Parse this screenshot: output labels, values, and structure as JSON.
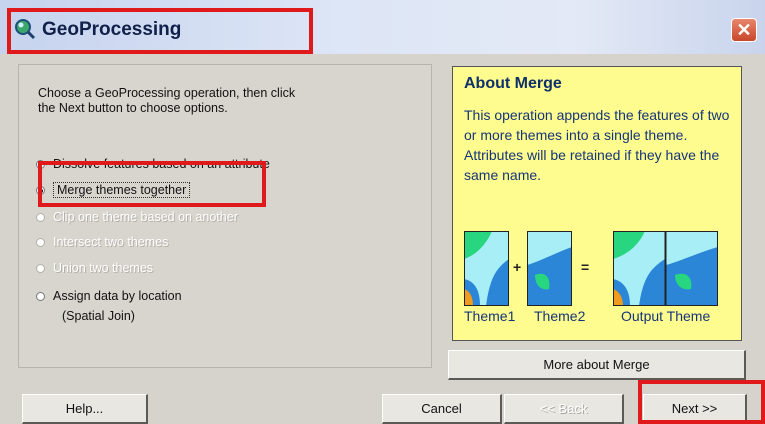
{
  "window": {
    "title": "GeoProcessing",
    "icon": "globe-magnifier-icon",
    "close_icon": "close-icon"
  },
  "instructions": "Choose a GeoProcessing operation, then click the Next button to choose options.",
  "options": [
    {
      "label": "Dissolve features based on an attribute",
      "selected": false,
      "enabled": true
    },
    {
      "label": "Merge themes together",
      "selected": true,
      "enabled": true
    },
    {
      "label": "Clip one theme based on another",
      "selected": false,
      "enabled": false
    },
    {
      "label": "Intersect two themes",
      "selected": false,
      "enabled": false
    },
    {
      "label": "Union two themes",
      "selected": false,
      "enabled": false
    },
    {
      "label": "Assign data by location",
      "label_line2": "(Spatial Join)",
      "selected": false,
      "enabled": true
    }
  ],
  "info": {
    "title": "About Merge",
    "body": "This operation appends the features of two or more themes into a single theme.  Attributes will be retained if they have the same name.",
    "captions": [
      "Theme1",
      "Theme2",
      "Output Theme"
    ],
    "plus": "+",
    "equals": "="
  },
  "buttons": {
    "more": "More about Merge",
    "help": "Help...",
    "cancel": "Cancel",
    "back": "<< Back",
    "next": "Next >>"
  },
  "colors": {
    "highlight": "#e01a1a",
    "info_background": "#fffc8f",
    "map_cyan": "#a8eef6",
    "map_blue": "#2b86d8",
    "map_green": "#27d67f",
    "map_orange": "#f09a1e"
  }
}
